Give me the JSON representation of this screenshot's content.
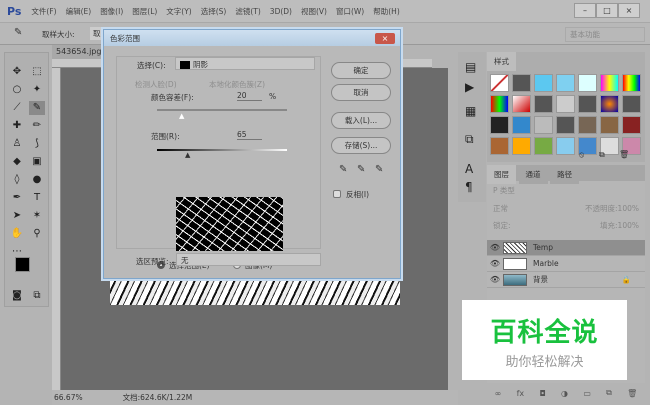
{
  "app": {
    "logo": "Ps",
    "menus": [
      "文件(F)",
      "编辑(E)",
      "图像(I)",
      "图层(L)",
      "文字(Y)",
      "选择(S)",
      "滤镜(T)",
      "3D(D)",
      "视图(V)",
      "窗口(W)",
      "帮助(H)"
    ],
    "win_min": "–",
    "win_max": "□",
    "win_close": "×"
  },
  "options": {
    "sample_label": "取样大小:",
    "sample_value": "取",
    "workspace": "基本功能"
  },
  "document": {
    "tab": "543654.jpg",
    "zoom": "66.67%",
    "doc_size": "文档:624.6K/1.22M"
  },
  "dialog": {
    "title": "色彩范围",
    "close": "×",
    "select_label": "选择(C):",
    "select_value": "阴影",
    "detect_faces": "检测人脸(D)",
    "localized": "本地化颜色簇(Z)",
    "fuzziness_label": "颜色容差(F):",
    "fuzziness_value": "20",
    "fuzziness_unit": "%",
    "range_label": "范围(R):",
    "range_value": "65",
    "radio_selection": "选择范围(E)",
    "radio_image": "图像(M)",
    "preview_label": "选区预览:",
    "preview_value": "无",
    "ok": "确定",
    "cancel": "取消",
    "load": "载入(L)...",
    "save": "存储(S)...",
    "invert": "反相(I)"
  },
  "styles_panel": {
    "tab": "样式"
  },
  "layers_panel": {
    "tabs": [
      "图层",
      "通道",
      "路径"
    ],
    "filter": "P 类型",
    "blend": "正常",
    "opacity_label": "不透明度:",
    "opacity": "100%",
    "lock_label": "锁定:",
    "fill_label": "填充:",
    "fill": "100%",
    "layers": [
      {
        "name": "Temp",
        "selected": true
      },
      {
        "name": "Marble",
        "selected": false
      },
      {
        "name": "背景",
        "selected": false,
        "locked": true
      }
    ]
  },
  "watermark": {
    "title": "百科全说",
    "subtitle": "助你轻松解决"
  }
}
